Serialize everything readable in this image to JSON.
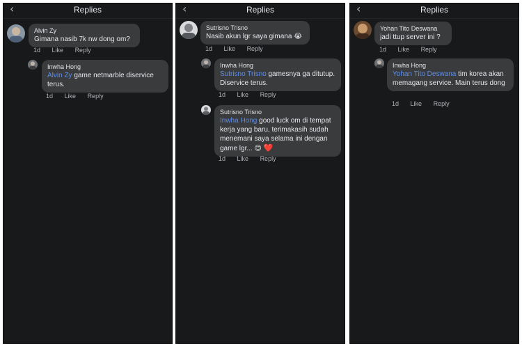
{
  "common": {
    "back_icon": "‹",
    "title": "Replies",
    "time": "1d",
    "like": "Like",
    "reply": "Reply"
  },
  "panel1": {
    "comment": {
      "author": "Alvin Zy",
      "text": "Gimana nasib 7k nw dong om?"
    },
    "reply": {
      "author": "Inwha Hong",
      "mention": "Alvin Zy",
      "text": " game netmarble diservice terus."
    }
  },
  "panel2": {
    "comment": {
      "author": "Sutrisno Trisno",
      "text": "Nasib akun lgr saya gimana"
    },
    "reply1": {
      "author": "Inwha Hong",
      "mention": "Sutrisno Trisno",
      "text": " gamesnya ga ditutup. Diservice terus."
    },
    "reply2": {
      "author": "Sutrisno Trisno",
      "mention": "Inwha Hong",
      "text": " good luck om di tempat kerja yang baru, terimakasih sudah menemani saya selama ini dengan game lgr...",
      "emoji_smile": "😊",
      "emoji_heart": "❤️"
    }
  },
  "panel3": {
    "comment": {
      "author": "Yohan Tito Deswana",
      "text": "jadi ttup server ini ?"
    },
    "reply": {
      "author": "Inwha Hong",
      "mention": "Yohan Tito Deswana",
      "text": " tim korea akan memagang service. Main terus dong"
    }
  }
}
